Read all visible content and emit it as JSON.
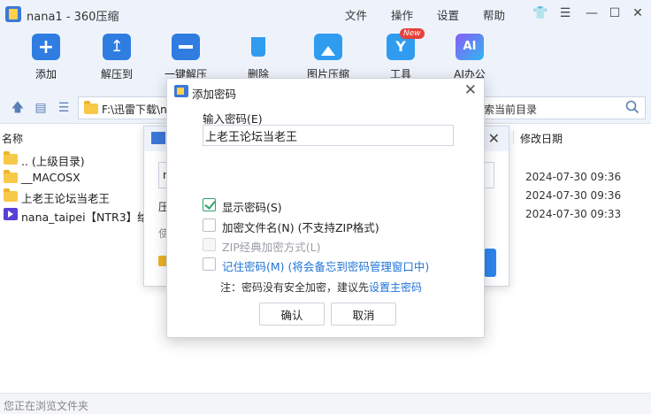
{
  "window": {
    "title": "nana1 - 360压缩",
    "menu": [
      "文件",
      "操作",
      "设置",
      "帮助"
    ]
  },
  "toolbar": {
    "items": [
      "添加",
      "解压到",
      "一键解压",
      "删除",
      "图片压缩",
      "工具",
      "AI办公"
    ],
    "new_badge": "New"
  },
  "address": {
    "path": "F:\\迅雷下载\\n",
    "search_text": "索当前目录"
  },
  "list": {
    "headers": {
      "name": "名称",
      "date": "修改日期"
    },
    "rows": [
      {
        "name": ".. (上级目录)",
        "date": ""
      },
      {
        "name": "__MACOSX",
        "date": "2024-07-30 09:36"
      },
      {
        "name": "上老王论坛当老王",
        "date": "2024-07-30 09:36"
      },
      {
        "name": "nana_taipei【NTR3】给老",
        "date": "2024-07-30 09:33"
      }
    ]
  },
  "status": {
    "text": "您正在浏览文件夹"
  },
  "back_dialog": {
    "field_text": "n",
    "label1": "压",
    "label2": "使"
  },
  "dialog": {
    "title": "添加密码",
    "password_label": "输入密码(E)",
    "password_value": "上老王论坛当老王",
    "options": [
      {
        "label": "显示密码(S)",
        "checked": true
      },
      {
        "label": "加密文件名(N) (不支持ZIP格式)",
        "checked": false
      },
      {
        "label": "ZIP经典加密方式(L)",
        "checked": false
      },
      {
        "label": "记住密码(M) (将会备忘到密码管理窗口中)",
        "checked": false
      }
    ],
    "note": "注：密码没有安全加密，建议先",
    "note_link": "设置主密码",
    "ok": "确认",
    "cancel": "取消"
  }
}
